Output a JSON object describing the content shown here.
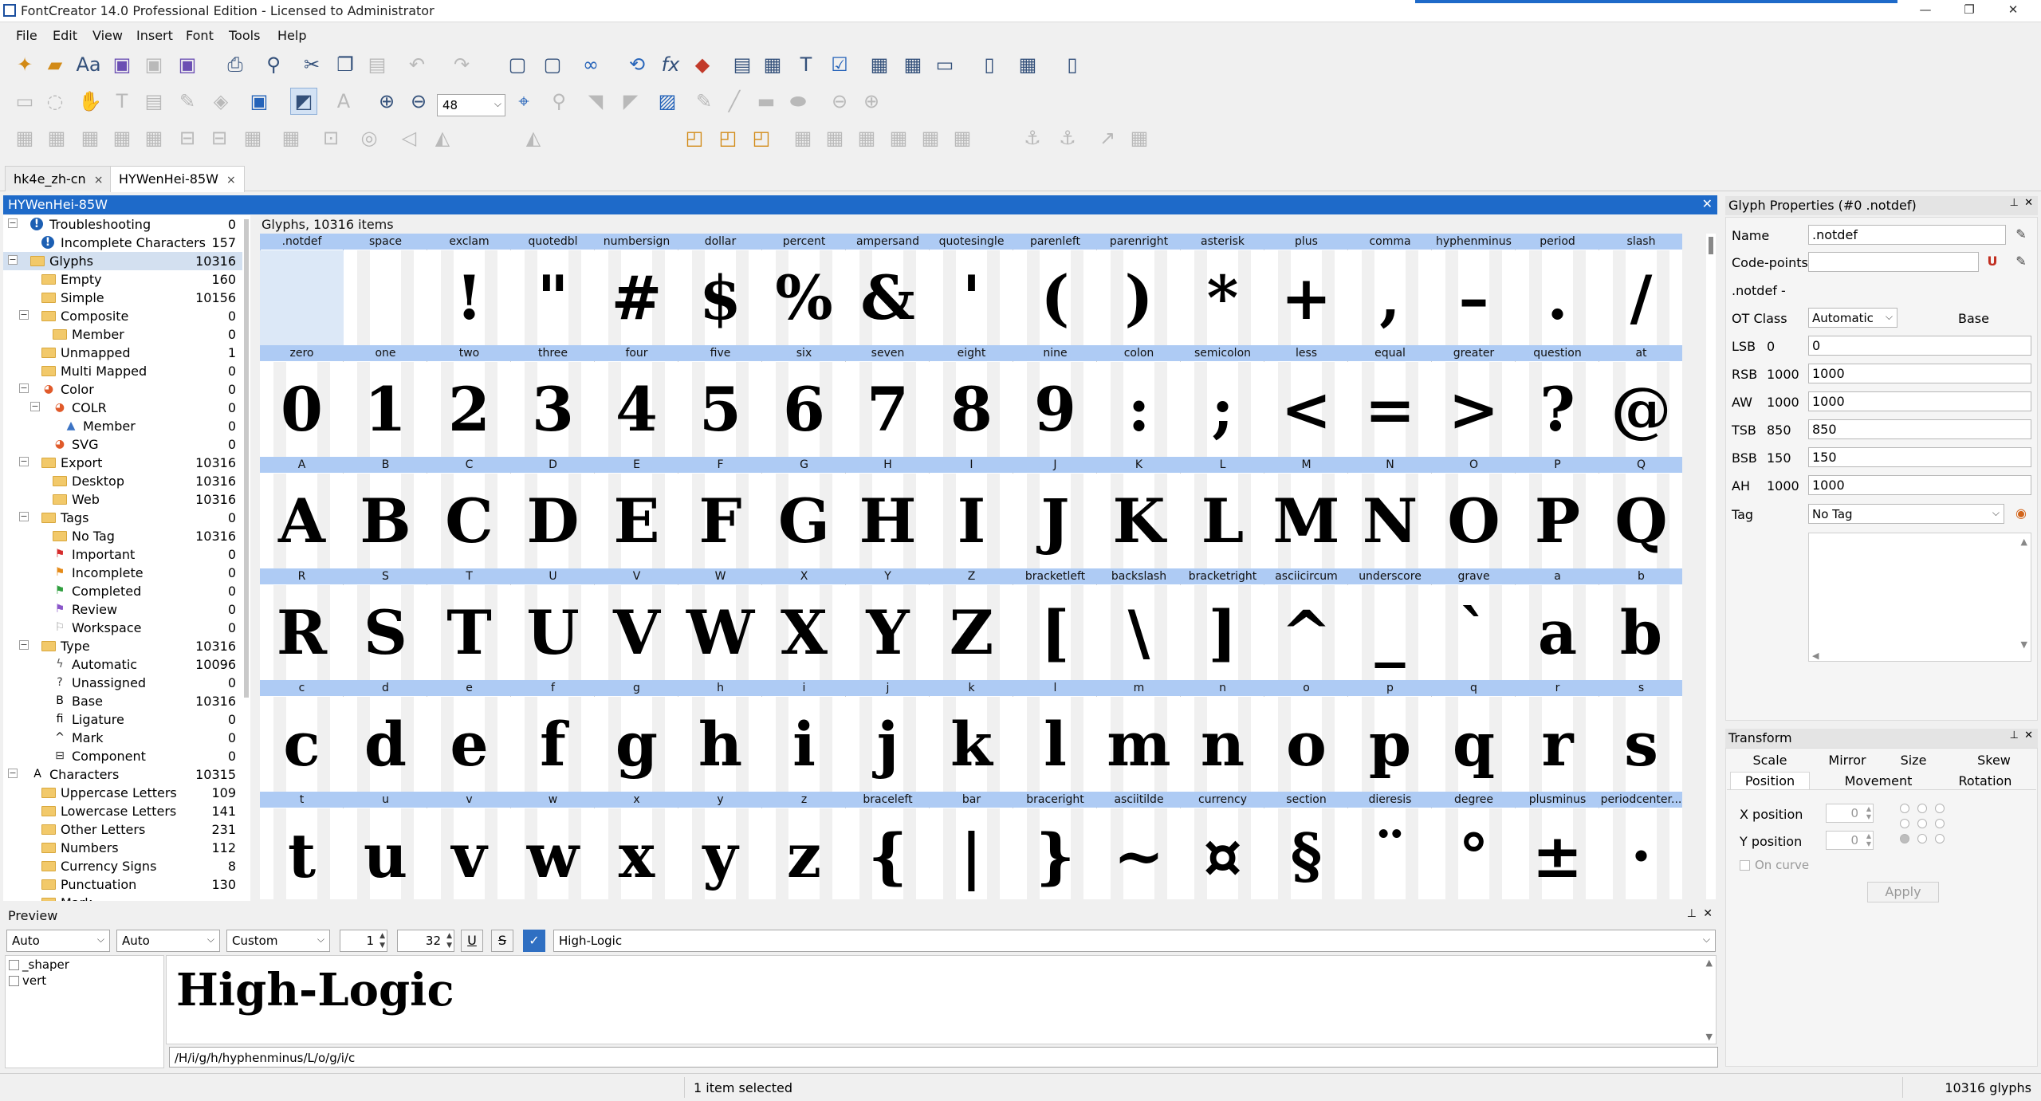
{
  "window": {
    "title": "FontCreator 14.0 Professional Edition - Licensed to Administrator"
  },
  "menu": [
    "File",
    "Edit",
    "View",
    "Insert",
    "Font",
    "Tools",
    "Help"
  ],
  "toolbar": {
    "zoom_value": "48",
    "icons_row1": [
      "new-file-icon",
      "open-folder-icon",
      "open-font-icon",
      "save-icon",
      "save-all-icon",
      "save-as-icon",
      "print-icon",
      "find-icon",
      "cut-icon",
      "copy-icon",
      "paste-icon",
      "undo-icon",
      "redo-icon",
      "insert-glyph-icon",
      "insert-char-icon",
      "link-icon",
      "refresh-icon",
      "formula-icon",
      "eraser-icon",
      "properties-icon",
      "metrics-icon",
      "text-icon",
      "validate-icon",
      "test-icon",
      "compare-icon",
      "export-icon",
      "page-icon",
      "sort-icon",
      "document-icon"
    ],
    "icons_row2": [
      "select-icon",
      "lasso-icon",
      "hand-icon",
      "type-icon",
      "knife-icon",
      "pen-icon",
      "fill-icon",
      "image-view-icon",
      "fill-style-icon",
      "text-style-icon",
      "zoom-in-icon",
      "zoom-out-icon",
      "fit-icon",
      "zoom-window-icon",
      "triangle-icon",
      "triangle2-icon",
      "image-icon",
      "brush-icon",
      "line-icon",
      "rectangle-icon",
      "ellipse-icon",
      "prev-icon",
      "next-icon"
    ],
    "icons_row3": [
      "align-icon",
      "group-icon",
      "ungroup-icon",
      "copy-contour-icon",
      "distribute-icon",
      "align-h-icon",
      "align-v-icon",
      "point-icon",
      "contour-icon",
      "component-icon",
      "bezier-icon",
      "arrow-left-icon",
      "triangle-3-icon",
      "triangle-4-icon",
      "shape-union-icon",
      "shape-intersect-icon",
      "shape-subtract-icon",
      "grid-icon",
      "grid2-icon",
      "grid3-icon",
      "grid4-icon",
      "grid5-icon",
      "grid6-icon",
      "anchor-icon",
      "anchor2-icon",
      "hint-icon",
      "table-icon"
    ]
  },
  "tabs": [
    {
      "label": "hk4e_zh-cn",
      "close": "×"
    },
    {
      "label": "HYWenHei-85W",
      "close": "×"
    }
  ],
  "glyph_panel": {
    "title": "HYWenHei-85W",
    "close": "✕",
    "caption": "Glyphs, 10316 items"
  },
  "tree": [
    {
      "label": "Troubleshooting",
      "count": "0",
      "level": 0,
      "icon": "warning-icon",
      "exp": "−"
    },
    {
      "label": "Incomplete Characters",
      "count": "157",
      "level": 1,
      "icon": "warning-icon"
    },
    {
      "label": "Glyphs",
      "count": "10316",
      "level": 0,
      "icon": "folder-icon",
      "exp": "−",
      "selected": true
    },
    {
      "label": "Empty",
      "count": "160",
      "level": 1,
      "icon": "folder-icon"
    },
    {
      "label": "Simple",
      "count": "10156",
      "level": 1,
      "icon": "folder-icon"
    },
    {
      "label": "Composite",
      "count": "0",
      "level": 1,
      "icon": "folder-icon",
      "exp": "−"
    },
    {
      "label": "Member",
      "count": "0",
      "level": 2,
      "icon": "folder-icon"
    },
    {
      "label": "Unmapped",
      "count": "1",
      "level": 1,
      "icon": "folder-icon"
    },
    {
      "label": "Multi Mapped",
      "count": "0",
      "level": 1,
      "icon": "folder-icon"
    },
    {
      "label": "Color",
      "count": "0",
      "level": 1,
      "icon": "color-wheel-icon",
      "exp": "−"
    },
    {
      "label": "COLR",
      "count": "0",
      "level": 2,
      "icon": "color-wheel-icon",
      "exp": "−"
    },
    {
      "label": "Member",
      "count": "0",
      "level": 3,
      "icon": "triangle-icon"
    },
    {
      "label": "SVG",
      "count": "0",
      "level": 2,
      "icon": "color-wheel-icon"
    },
    {
      "label": "Export",
      "count": "10316",
      "level": 1,
      "icon": "folder-icon",
      "exp": "−"
    },
    {
      "label": "Desktop",
      "count": "10316",
      "level": 2,
      "icon": "folder-icon"
    },
    {
      "label": "Web",
      "count": "10316",
      "level": 2,
      "icon": "folder-icon"
    },
    {
      "label": "Tags",
      "count": "0",
      "level": 1,
      "icon": "folder-icon",
      "exp": "−"
    },
    {
      "label": "No Tag",
      "count": "10316",
      "level": 2,
      "icon": "folder-icon"
    },
    {
      "label": "Important",
      "count": "0",
      "level": 2,
      "icon": "flag-red-icon"
    },
    {
      "label": "Incomplete",
      "count": "0",
      "level": 2,
      "icon": "flag-orange-icon"
    },
    {
      "label": "Completed",
      "count": "0",
      "level": 2,
      "icon": "flag-green-icon"
    },
    {
      "label": "Review",
      "count": "0",
      "level": 2,
      "icon": "flag-purple-icon"
    },
    {
      "label": "Workspace",
      "count": "0",
      "level": 2,
      "icon": "flag-outline-icon"
    },
    {
      "label": "Type",
      "count": "10316",
      "level": 1,
      "icon": "folder-icon",
      "exp": "−"
    },
    {
      "label": "Automatic",
      "count": "10096",
      "level": 2,
      "icon": "lightning-icon"
    },
    {
      "label": "Unassigned",
      "count": "0",
      "level": 2,
      "icon": "question-icon"
    },
    {
      "label": "Base",
      "count": "10316",
      "level": 2,
      "icon": "letter-b-icon"
    },
    {
      "label": "Ligature",
      "count": "0",
      "level": 2,
      "icon": "ligature-icon"
    },
    {
      "label": "Mark",
      "count": "0",
      "level": 2,
      "icon": "caret-icon"
    },
    {
      "label": "Component",
      "count": "0",
      "level": 2,
      "icon": "component-icon"
    },
    {
      "label": "Characters",
      "count": "10315",
      "level": 0,
      "icon": "letter-a-icon",
      "exp": "−"
    },
    {
      "label": "Uppercase Letters",
      "count": "109",
      "level": 1,
      "icon": "folder-icon"
    },
    {
      "label": "Lowercase Letters",
      "count": "141",
      "level": 1,
      "icon": "folder-icon"
    },
    {
      "label": "Other Letters",
      "count": "231",
      "level": 1,
      "icon": "folder-icon"
    },
    {
      "label": "Numbers",
      "count": "112",
      "level": 1,
      "icon": "folder-icon"
    },
    {
      "label": "Currency Signs",
      "count": "8",
      "level": 1,
      "icon": "folder-icon"
    },
    {
      "label": "Punctuation",
      "count": "130",
      "level": 1,
      "icon": "folder-icon"
    },
    {
      "label": "Mark",
      "count": "",
      "level": 1,
      "icon": "folder-icon"
    }
  ],
  "glyph_rows": [
    [
      [
        ".notdef",
        ""
      ],
      [
        "space",
        " "
      ],
      [
        "exclam",
        "!"
      ],
      [
        "quotedbl",
        "\""
      ],
      [
        "numbersign",
        "#"
      ],
      [
        "dollar",
        "$"
      ],
      [
        "percent",
        "%"
      ],
      [
        "ampersand",
        "&"
      ],
      [
        "quotesingle",
        "'"
      ],
      [
        "parenleft",
        "("
      ],
      [
        "parenright",
        ")"
      ],
      [
        "asterisk",
        "*"
      ],
      [
        "plus",
        "+"
      ],
      [
        "comma",
        ","
      ],
      [
        "hyphenminus",
        "–"
      ],
      [
        "period",
        "."
      ],
      [
        "slash",
        "/"
      ]
    ],
    [
      [
        "zero",
        "0"
      ],
      [
        "one",
        "1"
      ],
      [
        "two",
        "2"
      ],
      [
        "three",
        "3"
      ],
      [
        "four",
        "4"
      ],
      [
        "five",
        "5"
      ],
      [
        "six",
        "6"
      ],
      [
        "seven",
        "7"
      ],
      [
        "eight",
        "8"
      ],
      [
        "nine",
        "9"
      ],
      [
        "colon",
        ":"
      ],
      [
        "semicolon",
        ";"
      ],
      [
        "less",
        "<"
      ],
      [
        "equal",
        "="
      ],
      [
        "greater",
        ">"
      ],
      [
        "question",
        "?"
      ],
      [
        "at",
        "@"
      ]
    ],
    [
      [
        "A",
        "A"
      ],
      [
        "B",
        "B"
      ],
      [
        "C",
        "C"
      ],
      [
        "D",
        "D"
      ],
      [
        "E",
        "E"
      ],
      [
        "F",
        "F"
      ],
      [
        "G",
        "G"
      ],
      [
        "H",
        "H"
      ],
      [
        "I",
        "I"
      ],
      [
        "J",
        "J"
      ],
      [
        "K",
        "K"
      ],
      [
        "L",
        "L"
      ],
      [
        "M",
        "M"
      ],
      [
        "N",
        "N"
      ],
      [
        "O",
        "O"
      ],
      [
        "P",
        "P"
      ],
      [
        "Q",
        "Q"
      ]
    ],
    [
      [
        "R",
        "R"
      ],
      [
        "S",
        "S"
      ],
      [
        "T",
        "T"
      ],
      [
        "U",
        "U"
      ],
      [
        "V",
        "V"
      ],
      [
        "W",
        "W"
      ],
      [
        "X",
        "X"
      ],
      [
        "Y",
        "Y"
      ],
      [
        "Z",
        "Z"
      ],
      [
        "bracketleft",
        "["
      ],
      [
        "backslash",
        "\\"
      ],
      [
        "bracketright",
        "]"
      ],
      [
        "asciicircum",
        "^"
      ],
      [
        "underscore",
        "_"
      ],
      [
        "grave",
        "`"
      ],
      [
        "a",
        "a"
      ],
      [
        "b",
        "b"
      ]
    ],
    [
      [
        "c",
        "c"
      ],
      [
        "d",
        "d"
      ],
      [
        "e",
        "e"
      ],
      [
        "f",
        "f"
      ],
      [
        "g",
        "g"
      ],
      [
        "h",
        "h"
      ],
      [
        "i",
        "i"
      ],
      [
        "j",
        "j"
      ],
      [
        "k",
        "k"
      ],
      [
        "l",
        "l"
      ],
      [
        "m",
        "m"
      ],
      [
        "n",
        "n"
      ],
      [
        "o",
        "o"
      ],
      [
        "p",
        "p"
      ],
      [
        "q",
        "q"
      ],
      [
        "r",
        "r"
      ],
      [
        "s",
        "s"
      ]
    ],
    [
      [
        "t",
        "t"
      ],
      [
        "u",
        "u"
      ],
      [
        "v",
        "v"
      ],
      [
        "w",
        "w"
      ],
      [
        "x",
        "x"
      ],
      [
        "y",
        "y"
      ],
      [
        "z",
        "z"
      ],
      [
        "braceleft",
        "{"
      ],
      [
        "bar",
        "|"
      ],
      [
        "braceright",
        "}"
      ],
      [
        "asciitilde",
        "~"
      ],
      [
        "currency",
        "¤"
      ],
      [
        "section",
        "§"
      ],
      [
        "dieresis",
        "¨"
      ],
      [
        "degree",
        "°"
      ],
      [
        "plusminus",
        "±"
      ],
      [
        "periodcenter...",
        "·"
      ]
    ]
  ],
  "preview": {
    "title": "Preview",
    "pin": "⊥",
    "close": "✕",
    "select1": "Auto",
    "select2": "Auto",
    "select3": "Custom",
    "spin1": "1",
    "spin2": "32",
    "underline": "U",
    "strike": "S",
    "check": "✓",
    "text_input": "High-Logic",
    "features": [
      "_shaper",
      "vert"
    ],
    "sample": "High-Logic",
    "path": "/H/i/g/h/hyphenminus/L/o/g/i/c"
  },
  "properties": {
    "title": "Glyph Properties (#0 .notdef)",
    "name_label": "Name",
    "name_value": ".notdef",
    "codepoints_label": "Code-points",
    "codepoints_value": "",
    "glyph_line": ".notdef -",
    "otclass_label": "OT Class",
    "otclass_value": "Automatic",
    "otclass_extra": "Base",
    "metrics": [
      {
        "label": "LSB",
        "value": "0",
        "field": "0"
      },
      {
        "label": "RSB",
        "value": "1000",
        "field": "1000"
      },
      {
        "label": "AW",
        "value": "1000",
        "field": "1000"
      },
      {
        "label": "TSB",
        "value": "850",
        "field": "850"
      },
      {
        "label": "BSB",
        "value": "150",
        "field": "150"
      },
      {
        "label": "AH",
        "value": "1000",
        "field": "1000"
      }
    ],
    "tag_label": "Tag",
    "tag_value": "No Tag"
  },
  "transform": {
    "title": "Transform",
    "tabs_row1": [
      "Scale",
      "Mirror",
      "Size",
      "Skew"
    ],
    "tabs_row2": [
      "Position",
      "Movement",
      "Rotation"
    ],
    "xpos_label": "X position",
    "xpos_value": "0",
    "ypos_label": "Y position",
    "ypos_value": "0",
    "oncurve_label": "On curve",
    "apply_label": "Apply"
  },
  "status": {
    "selected": "1 item selected",
    "total": "10316 glyphs"
  }
}
